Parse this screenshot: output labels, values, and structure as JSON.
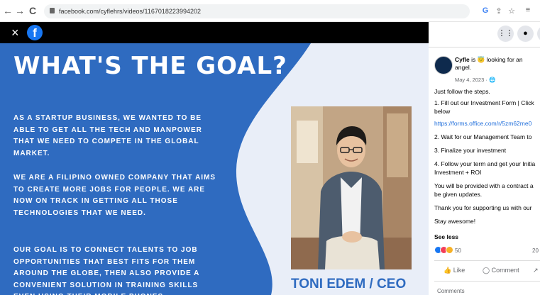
{
  "browser": {
    "url": "facebook.com/cyflehrs/videos/1167018223994202",
    "back_icon": "←",
    "forward_icon": "→",
    "reload_icon": "C",
    "google_icon": "G",
    "share_icon": "⇪",
    "star_icon": "☆",
    "menu_icon": "≡"
  },
  "viewer": {
    "close_icon": "×",
    "fb_logo": "f"
  },
  "slide": {
    "headline": "WHAT'S THE GOAL?",
    "paragraphs": [
      "AS A STARTUP BUSINESS, WE WANTED TO BE ABLE TO GET ALL THE TECH AND MANPOWER THAT WE NEED TO COMPETE IN THE GLOBAL MARKET.",
      "WE ARE A FILIPINO OWNED COMPANY THAT AIMS TO CREATE MORE JOBS FOR PEOPLE. WE ARE NOW ON TRACK IN GETTING ALL THOSE TECHNOLOGIES THAT WE NEED.",
      "OUR GOAL IS TO CONNECT TALENTS TO JOB OPPORTUNITIES THAT BEST FITS FOR THEM AROUND THE GLOBE, THEN ALSO PROVIDE A CONVENIENT SOLUTION IN TRAINING SKILLS EVEN USING THEIR MOBILE PHONES."
    ],
    "caption": "TONI EDEM / CEO",
    "colors": {
      "blue": "#2f6bc0",
      "light": "#e9eef8"
    }
  },
  "side": {
    "grid_icon": "⋮⋮",
    "messenger_icon": "●",
    "author_name": "Cyfle",
    "author_status": " is 😇 looking for an angel.",
    "date": "May 4, 2023 · 🌐",
    "lines": [
      "Just follow the steps.",
      "1. Fill out our Investment Form | Click",
      "below",
      "https://forms.office.com/r/5zm62me0",
      "2. Wait for our Management Team to",
      "3. Finalize your investment",
      "4. Follow your term and get your Initia",
      "Investment + ROI",
      "You will be provided with a contract a",
      "be given updates.",
      "Thank you for supporting us with our",
      "Stay awesome!"
    ],
    "see_less": "See less",
    "reaction_count": "50",
    "reaction_right": "20",
    "like_label": "Like",
    "comment_label": "Comment",
    "comments_label": "Comments",
    "like_icon": "👍",
    "comment_icon": "◯",
    "share_icon": "↗"
  }
}
